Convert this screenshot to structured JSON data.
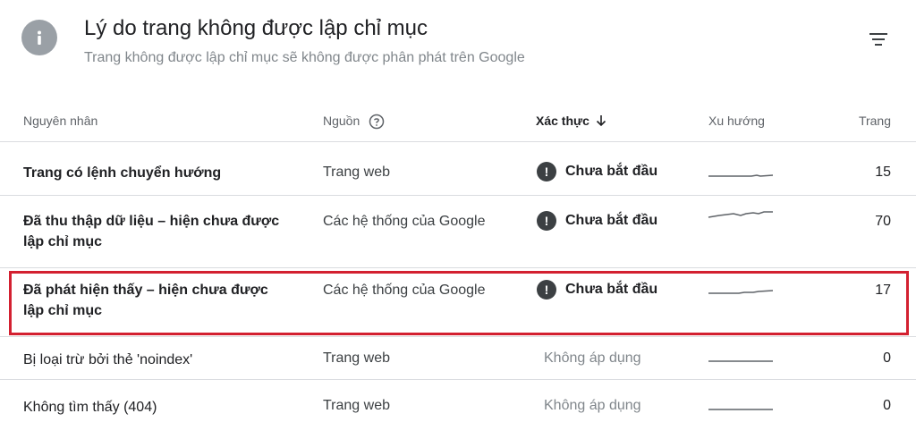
{
  "header": {
    "title": "Lý do trang không được lập chỉ mục",
    "subtitle": "Trang không được lập chỉ mục sẽ không được phân phát trên Google",
    "icons": {
      "info": "info-icon",
      "filter": "filter-icon"
    }
  },
  "table": {
    "columns": {
      "reason": "Nguyên nhân",
      "source": "Nguồn",
      "validation": "Xác thực",
      "trend": "Xu hướng",
      "pages": "Trang"
    },
    "rows": [
      {
        "reason_line1": "Trang có lệnh chuyển hướng",
        "reason_line2": "",
        "source": "Trang web",
        "status": "Chưa bắt đầu",
        "pages": "15"
      },
      {
        "reason_line1": "Đã thu thập dữ liệu – hiện chưa được",
        "reason_line2": "lập chỉ mục",
        "source": "Các hệ thống của Google",
        "status": "Chưa bắt đầu",
        "pages": "70"
      },
      {
        "reason_line1": "Đã phát hiện thấy – hiện chưa được",
        "reason_line2": "lập chỉ mục",
        "source": "Các hệ thống của Google",
        "status": "Chưa bắt đầu",
        "pages": "17"
      },
      {
        "reason_line1": "Bị loại trừ bởi thẻ 'noindex'",
        "reason_line2": "",
        "source": "Trang web",
        "status": "Không áp dụng",
        "pages": "0"
      },
      {
        "reason_line1": "Không tìm thấy (404)",
        "reason_line2": "",
        "source": "Trang web",
        "status": "Không áp dụng",
        "pages": "0"
      }
    ]
  },
  "colors": {
    "highlight": "#d32030",
    "status_icon": "#3c4043"
  }
}
